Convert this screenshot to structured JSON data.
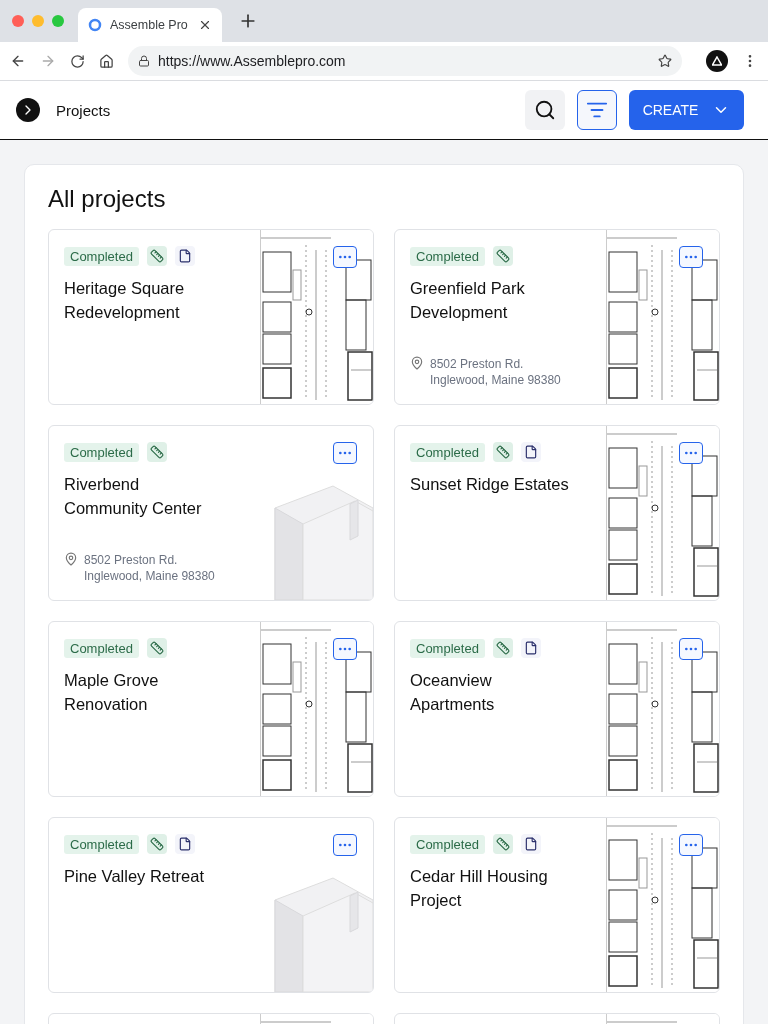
{
  "browser": {
    "tab_title": "Assemble Pro",
    "url": "https://www.Assemblepro.com"
  },
  "header": {
    "title": "Projects",
    "create_label": "CREATE"
  },
  "page": {
    "title": "All projects"
  },
  "projects": [
    {
      "status": "Completed",
      "has_document": true,
      "title": "Heritage Square Redevelopment",
      "kind": "floorplan"
    },
    {
      "status": "Completed",
      "has_document": false,
      "title": "Greenfield Park Development",
      "address": [
        "8502 Preston Rd.",
        "Inglewood, Maine 98380"
      ],
      "kind": "floorplan"
    },
    {
      "status": "Completed",
      "has_document": false,
      "title": "Riverbend Community Center",
      "address": [
        "8502 Preston Rd.",
        "Inglewood, Maine 98380"
      ],
      "kind": "building"
    },
    {
      "status": "Completed",
      "has_document": true,
      "title": "Sunset Ridge Estates",
      "kind": "floorplan"
    },
    {
      "status": "Completed",
      "has_document": false,
      "title": "Maple Grove Renovation",
      "kind": "floorplan"
    },
    {
      "status": "Completed",
      "has_document": true,
      "title": "Oceanview Apartments",
      "kind": "floorplan"
    },
    {
      "status": "Completed",
      "has_document": true,
      "title": "Pine Valley Retreat",
      "kind": "building"
    },
    {
      "status": "Completed",
      "has_document": true,
      "title": "Cedar Hill Housing Project",
      "kind": "floorplan"
    },
    {
      "kind": "floorplan"
    },
    {
      "kind": "floorplan"
    }
  ]
}
